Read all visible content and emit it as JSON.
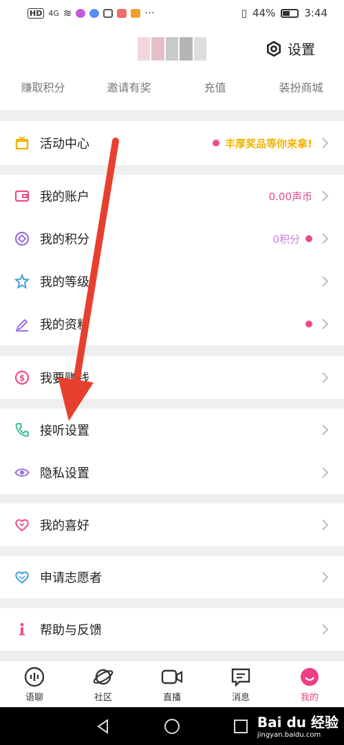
{
  "status_bar": {
    "network": "HD",
    "signal": "4G",
    "more": "···",
    "battery_percent": "44%",
    "battery_level": 0.44,
    "time": "3:44"
  },
  "header": {
    "settings_label": "设置",
    "quick_links": [
      "赚取积分",
      "邀请有奖",
      "充值",
      "装扮商城"
    ]
  },
  "menu": {
    "activity": {
      "label": "活动中心",
      "promo": "丰厚奖品等你来拿!",
      "promo_color": "#f0b400"
    },
    "account": {
      "label": "我的账户",
      "value": "0.00声币"
    },
    "points": {
      "label": "我的积分",
      "value": "0积分"
    },
    "level": {
      "label": "我的等级"
    },
    "profile": {
      "label": "我的资料"
    },
    "earn": {
      "label": "我要赚钱"
    },
    "answer_settings": {
      "label": "接听设置"
    },
    "privacy_settings": {
      "label": "隐私设置"
    },
    "preferences": {
      "label": "我的喜好"
    },
    "volunteer": {
      "label": "申请志愿者"
    },
    "help": {
      "label": "帮助与反馈"
    }
  },
  "tabs": [
    {
      "label": "语聊",
      "icon": "voice-chat-icon"
    },
    {
      "label": "社区",
      "icon": "planet-icon"
    },
    {
      "label": "直播",
      "icon": "video-camera-icon"
    },
    {
      "label": "消息",
      "icon": "message-icon"
    },
    {
      "label": "我的",
      "icon": "profile-face-icon",
      "active": true
    }
  ],
  "colors": {
    "accent": "#ee3e84",
    "arrow": "#e8402f"
  },
  "watermark": {
    "brand": "Bai du 经验",
    "url": "jingyan.baidu.com"
  }
}
